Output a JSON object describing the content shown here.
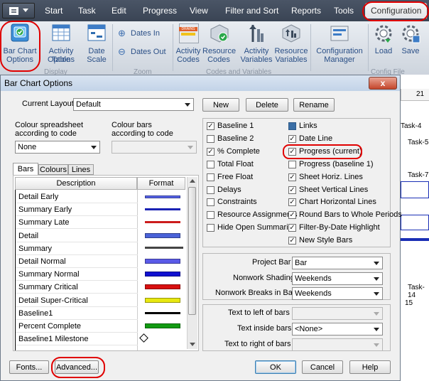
{
  "ribbon": {
    "tabs": [
      "Start",
      "Task",
      "Edit",
      "Progress",
      "View",
      "Filter and Sort",
      "Reports",
      "Tools",
      "Configuration"
    ],
    "buttons": {
      "bar_chart_options": [
        "Bar Chart",
        "Options"
      ],
      "activity_table_options": [
        "Activity Table",
        "Options"
      ],
      "date_scale": [
        "Date",
        "Scale"
      ],
      "dates_in": "Dates In",
      "dates_out": "Dates Out",
      "activity_codes": [
        "Activity",
        "Codes"
      ],
      "resource_codes": [
        "Resource",
        "Codes"
      ],
      "activity_variables": [
        "Activity",
        "Variables"
      ],
      "resource_variables": [
        "Resource",
        "Variables"
      ],
      "configuration_manager": [
        "Configuration",
        "Manager"
      ],
      "load": "Load",
      "save": "Save"
    },
    "groups": [
      "Display",
      "Zoom",
      "Codes and Variables",
      "Config File"
    ],
    "icon_badge": "DRAINS"
  },
  "gantt": {
    "date_header": "21",
    "tasks": [
      "Task-4",
      "Task-5",
      "Task-7",
      "Task-14"
    ],
    "row_num": "15"
  },
  "dialog": {
    "title": "Bar Chart Options",
    "close_symbol": "x",
    "current_layout_label": "Current Layout",
    "current_layout_value": "Default",
    "new_label": "New",
    "delete_label": "Delete",
    "rename_label": "Rename",
    "colour_spreadsheet_label": [
      "Colour spreadsheet",
      "according to code"
    ],
    "colour_spreadsheet_value": "None",
    "colour_bars_label": [
      "Colour bars",
      "according to code"
    ],
    "tabs": [
      "Bars",
      "Colours",
      "Lines"
    ],
    "table_headers": [
      "Description",
      "Format"
    ],
    "bars": [
      {
        "desc": "Detail Early",
        "color": "#5563e8",
        "style": "thick"
      },
      {
        "desc": "Summary Early",
        "color": "#1a22b4",
        "style": "thin"
      },
      {
        "desc": "Summary Late",
        "color": "#cc1c1c",
        "style": "thin"
      },
      {
        "desc": "Detail",
        "color": "#4a62d8",
        "style": "block"
      },
      {
        "desc": "Summary",
        "color": "#444444",
        "style": "summary"
      },
      {
        "desc": "Detail Normal",
        "color": "#5a5ae8",
        "style": "block"
      },
      {
        "desc": "Summary Normal",
        "color": "#1010d0",
        "style": "block"
      },
      {
        "desc": "Summary Critical",
        "color": "#d81010",
        "style": "block"
      },
      {
        "desc": "Detail Super-Critical",
        "color": "#e8e810",
        "style": "block"
      },
      {
        "desc": "Baseline1",
        "color": "#000000",
        "style": "thin"
      },
      {
        "desc": "Percent Complete",
        "color": "#129a12",
        "style": "block"
      },
      {
        "desc": "Baseline1 Milestone",
        "color": "#000000",
        "style": "diamond"
      }
    ],
    "checks_col1": [
      {
        "label": "Baseline 1",
        "checked": true
      },
      {
        "label": "Baseline 2",
        "checked": false
      },
      {
        "label": "% Complete",
        "checked": true
      },
      {
        "label": "Total Float",
        "checked": false
      },
      {
        "label": "Free Float",
        "checked": false
      },
      {
        "label": "Delays",
        "checked": false
      },
      {
        "label": "Constraints",
        "checked": false
      },
      {
        "label": "Resource Assignments",
        "checked": false
      },
      {
        "label": "Hide Open Summaries",
        "checked": false
      }
    ],
    "checks_col2": [
      {
        "label": "Links",
        "checked": true,
        "filled": true
      },
      {
        "label": "Date Line",
        "checked": true
      },
      {
        "label": "Progress (current)",
        "checked": true
      },
      {
        "label": "Progress (baseline 1)",
        "checked": false
      },
      {
        "label": "Sheet Horiz. Lines",
        "checked": true
      },
      {
        "label": "Sheet Vertical Lines",
        "checked": true
      },
      {
        "label": "Chart Horizontal Lines",
        "checked": true
      },
      {
        "label": "Round Bars to Whole Periods",
        "checked": true
      },
      {
        "label": "Filter-By-Date Highlight",
        "checked": true
      },
      {
        "label": "New Style Bars",
        "checked": true
      }
    ],
    "project_bar_label": "Project Bar",
    "project_bar_value": "Bar",
    "nonwork_shading_label": "Nonwork Shading",
    "nonwork_shading_value": "Weekends",
    "nonwork_breaks_label": "Nonwork Breaks in Bars",
    "nonwork_breaks_value": "Weekends",
    "text_left_label": "Text to left of bars",
    "text_left_value": "",
    "text_inside_label": "Text inside bars",
    "text_inside_value": "<None>",
    "text_right_label": "Text to right of bars",
    "text_right_value": "",
    "fonts_label": "Fonts...",
    "advanced_label": "Advanced...",
    "ok_label": "OK",
    "cancel_label": "Cancel",
    "help_label": "Help"
  }
}
